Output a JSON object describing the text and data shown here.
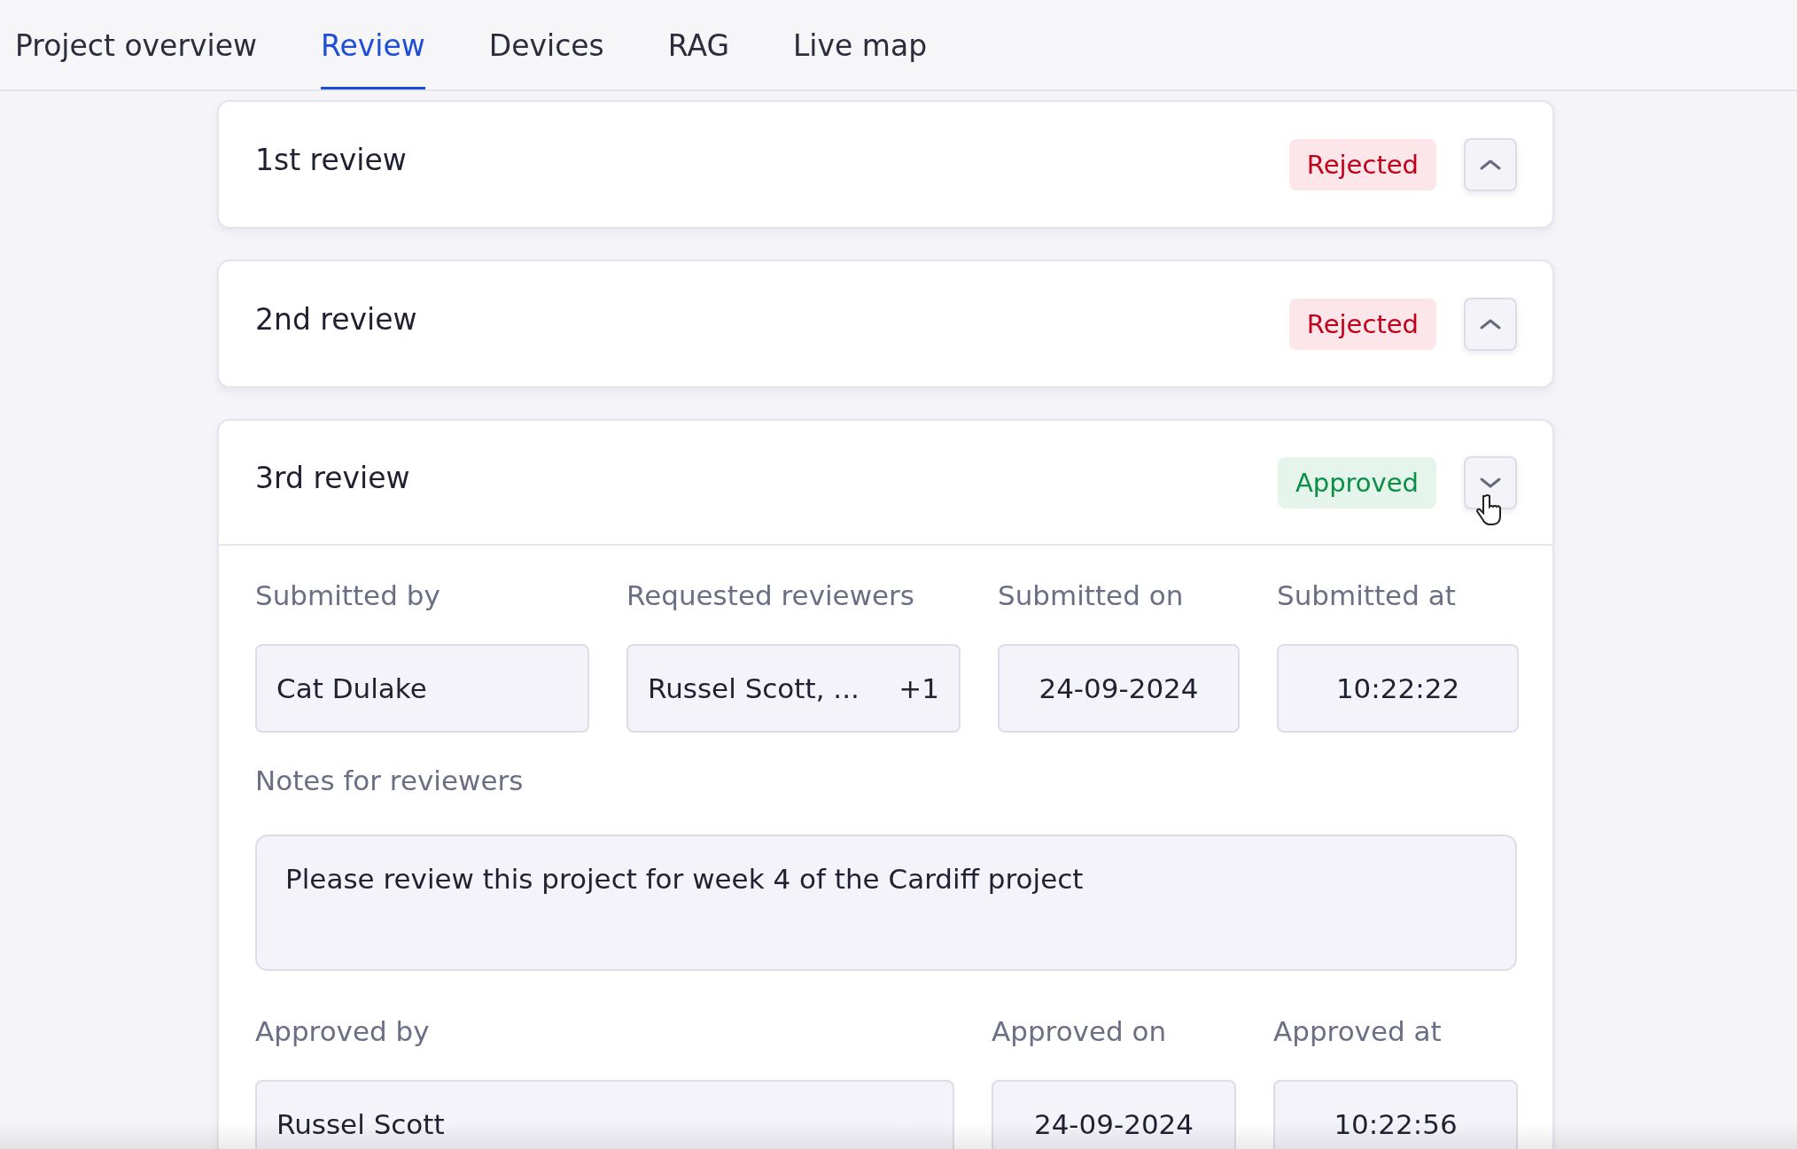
{
  "tabs": [
    {
      "label": "Project overview",
      "selected": false
    },
    {
      "label": "Review",
      "selected": true
    },
    {
      "label": "Devices",
      "selected": false
    },
    {
      "label": "RAG",
      "selected": false
    },
    {
      "label": "Live map",
      "selected": false
    }
  ],
  "reviews": [
    {
      "title": "1st review",
      "status": {
        "label": "Rejected",
        "kind": "rejected"
      },
      "expanded": false
    },
    {
      "title": "2nd review",
      "status": {
        "label": "Rejected",
        "kind": "rejected"
      },
      "expanded": false
    },
    {
      "title": "3rd review",
      "status": {
        "label": "Approved",
        "kind": "approved"
      },
      "expanded": true,
      "submission": [
        {
          "label": "Submitted by",
          "value": "Cat Dulake",
          "kind": "person"
        },
        {
          "label": "Requested reviewers",
          "value": "Russel Scott, ...",
          "extra": "+1",
          "kind": "person"
        },
        {
          "label": "Submitted on",
          "value": "24-09-2024",
          "kind": "date"
        },
        {
          "label": "Submitted at",
          "value": "10:22:22",
          "kind": "time"
        }
      ],
      "notes": {
        "label": "Notes for reviewers",
        "value": "Please review this project for week 4 of the Cardiff project"
      },
      "approval": [
        {
          "label": "Approved by",
          "value": "Russel Scott",
          "kind": "person"
        },
        {
          "label": "Approved on",
          "value": "24-09-2024",
          "kind": "date"
        },
        {
          "label": "Approved at",
          "value": "10:22:56",
          "kind": "time"
        }
      ]
    }
  ]
}
